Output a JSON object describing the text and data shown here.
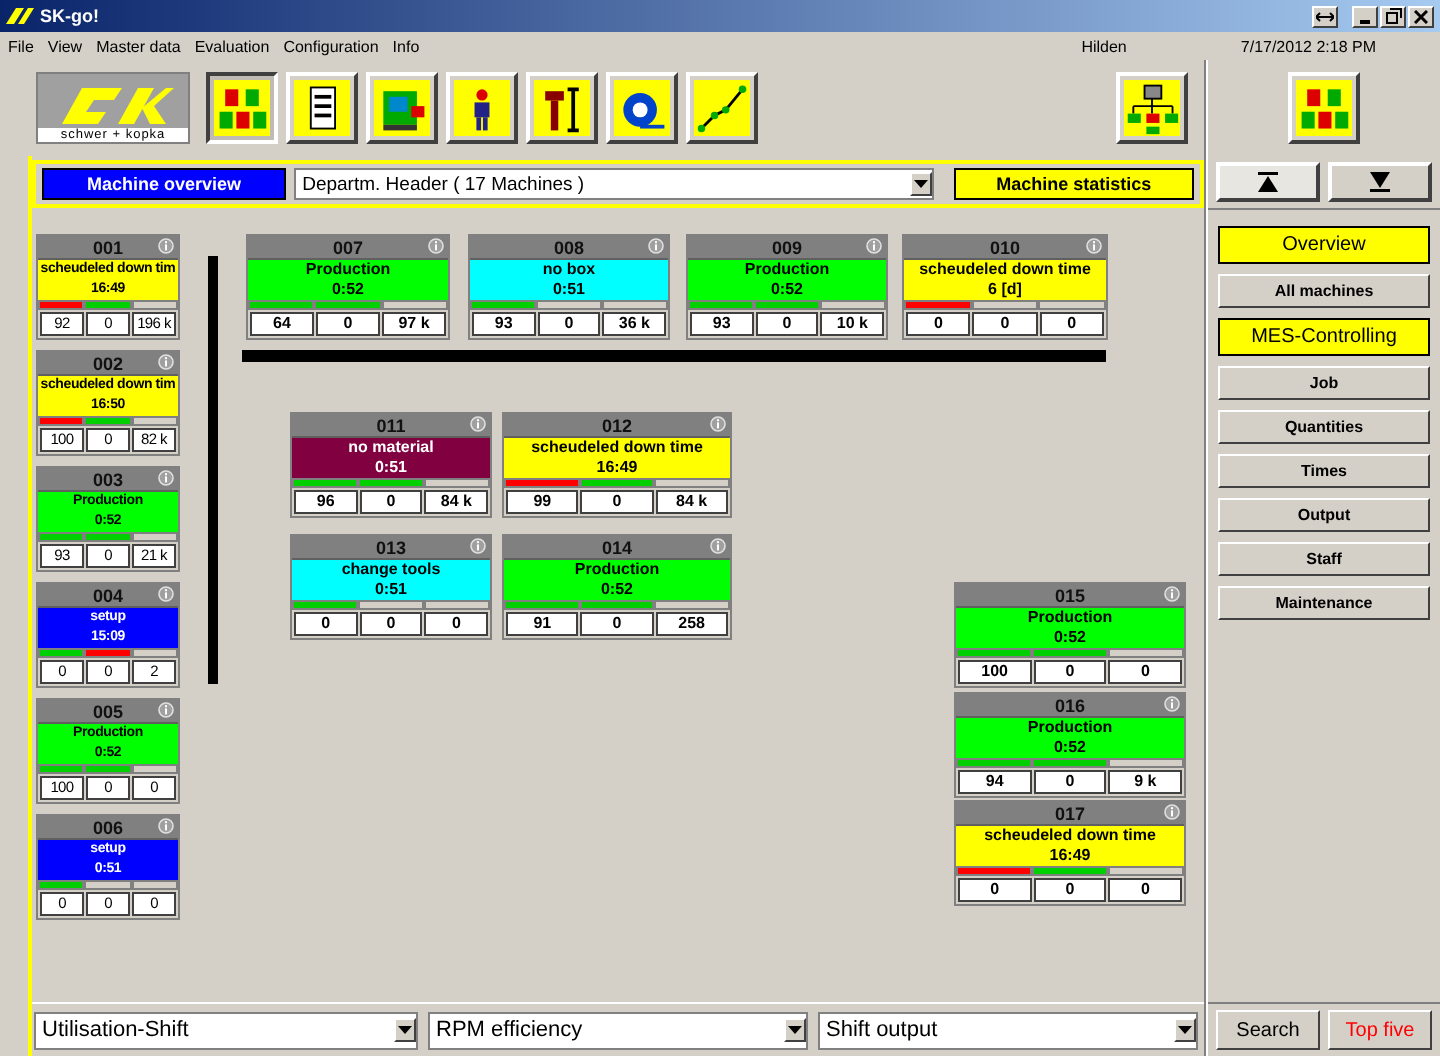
{
  "window": {
    "title": "SK-go!"
  },
  "menu": [
    "File",
    "View",
    "Master data",
    "Evaluation",
    "Configuration",
    "Info"
  ],
  "location": "Hilden",
  "datetime": "7/17/2012 2:18 PM",
  "logo": {
    "caption": "schwer + kopka"
  },
  "toolbar": [
    {
      "selected": true
    },
    {
      "selected": false
    },
    {
      "selected": false
    },
    {
      "selected": false
    },
    {
      "selected": false
    },
    {
      "selected": false
    },
    {
      "selected": false
    }
  ],
  "view_tabs": [
    {
      "label": "Machine overview",
      "selected": true
    },
    {
      "label": "Machine statistics",
      "selected": false
    }
  ],
  "department": {
    "value": "Departm. Header ( 17 Machines )"
  },
  "machines": [
    {
      "number": "001",
      "status": "scheudeled down tim",
      "time": "16:49",
      "color": "#ffff00",
      "bars": [
        {
          "color": "#ff0000"
        },
        {
          "color": "#00d000"
        },
        {
          "color": "#d4d0c8"
        }
      ],
      "values": [
        "92",
        "0",
        "196 k"
      ]
    },
    {
      "number": "002",
      "status": "scheudeled down tim",
      "time": "16:50",
      "color": "#ffff00",
      "bars": [
        {
          "color": "#ff0000"
        },
        {
          "color": "#00d000"
        },
        {
          "color": "#d4d0c8"
        }
      ],
      "values": [
        "100",
        "0",
        "82 k"
      ]
    },
    {
      "number": "003",
      "status": "Production",
      "time": "0:52",
      "color": "#00ff00",
      "bars": [
        {
          "color": "#00d000"
        },
        {
          "color": "#00d000"
        },
        {
          "color": "#d4d0c8"
        }
      ],
      "values": [
        "93",
        "0",
        "21 k"
      ]
    },
    {
      "number": "004",
      "status": "setup",
      "time": "15:09",
      "color": "#0000ff",
      "bars": [
        {
          "color": "#00d000"
        },
        {
          "color": "#ff0000"
        },
        {
          "color": "#d4d0c8"
        }
      ],
      "values": [
        "0",
        "0",
        "2"
      ]
    },
    {
      "number": "005",
      "status": "Production",
      "time": "0:52",
      "color": "#00ff00",
      "bars": [
        {
          "color": "#00d000"
        },
        {
          "color": "#00d000"
        },
        {
          "color": "#d4d0c8"
        }
      ],
      "values": [
        "100",
        "0",
        "0"
      ]
    },
    {
      "number": "006",
      "status": "setup",
      "time": "0:51",
      "color": "#0000ff",
      "bars": [
        {
          "color": "#00d000"
        },
        {
          "color": "#d4d0c8"
        },
        {
          "color": "#d4d0c8"
        }
      ],
      "values": [
        "0",
        "0",
        "0"
      ]
    },
    {
      "number": "007",
      "status": "Production",
      "time": "0:52",
      "color": "#00ff00",
      "bars": [
        {
          "color": "#00d000"
        },
        {
          "color": "#00d000"
        },
        {
          "color": "#d4d0c8"
        }
      ],
      "values": [
        "64",
        "0",
        "97 k"
      ]
    },
    {
      "number": "008",
      "status": "no box",
      "time": "0:51",
      "color": "#00ffff",
      "bars": [
        {
          "color": "#00d000"
        },
        {
          "color": "#d4d0c8"
        },
        {
          "color": "#d4d0c8"
        }
      ],
      "values": [
        "93",
        "0",
        "36 k"
      ]
    },
    {
      "number": "009",
      "status": "Production",
      "time": "0:52",
      "color": "#00ff00",
      "bars": [
        {
          "color": "#00d000"
        },
        {
          "color": "#00d000"
        },
        {
          "color": "#d4d0c8"
        }
      ],
      "values": [
        "93",
        "0",
        "10 k"
      ]
    },
    {
      "number": "010",
      "status": "scheudeled down time",
      "time": "6 [d]",
      "color": "#ffff00",
      "bars": [
        {
          "color": "#ff0000"
        },
        {
          "color": "#d4d0c8"
        },
        {
          "color": "#d4d0c8"
        }
      ],
      "values": [
        "0",
        "0",
        "0"
      ]
    },
    {
      "number": "011",
      "status": "no material",
      "time": "0:51",
      "color": "#800040",
      "bars": [
        {
          "color": "#00d000"
        },
        {
          "color": "#00d000"
        },
        {
          "color": "#d4d0c8"
        }
      ],
      "values": [
        "96",
        "0",
        "84 k"
      ]
    },
    {
      "number": "012",
      "status": "scheudeled down time",
      "time": "16:49",
      "color": "#ffff00",
      "bars": [
        {
          "color": "#ff0000"
        },
        {
          "color": "#00d000"
        },
        {
          "color": "#d4d0c8"
        }
      ],
      "values": [
        "99",
        "0",
        "84 k"
      ]
    },
    {
      "number": "013",
      "status": "change tools",
      "time": "0:51",
      "color": "#00ffff",
      "bars": [
        {
          "color": "#00d000"
        },
        {
          "color": "#d4d0c8"
        },
        {
          "color": "#d4d0c8"
        }
      ],
      "values": [
        "0",
        "0",
        "0"
      ]
    },
    {
      "number": "014",
      "status": "Production",
      "time": "0:52",
      "color": "#00ff00",
      "bars": [
        {
          "color": "#00d000"
        },
        {
          "color": "#00d000"
        },
        {
          "color": "#d4d0c8"
        }
      ],
      "values": [
        "91",
        "0",
        "258"
      ]
    },
    {
      "number": "015",
      "status": "Production",
      "time": "0:52",
      "color": "#00ff00",
      "bars": [
        {
          "color": "#00d000"
        },
        {
          "color": "#00d000"
        },
        {
          "color": "#d4d0c8"
        }
      ],
      "values": [
        "100",
        "0",
        "0"
      ]
    },
    {
      "number": "016",
      "status": "Production",
      "time": "0:52",
      "color": "#00ff00",
      "bars": [
        {
          "color": "#00d000"
        },
        {
          "color": "#00d000"
        },
        {
          "color": "#d4d0c8"
        }
      ],
      "values": [
        "94",
        "0",
        "9 k"
      ]
    },
    {
      "number": "017",
      "status": "scheudeled down time",
      "time": "16:49",
      "color": "#ffff00",
      "bars": [
        {
          "color": "#ff0000"
        },
        {
          "color": "#00d000"
        },
        {
          "color": "#d4d0c8"
        }
      ],
      "values": [
        "0",
        "0",
        "0"
      ]
    }
  ],
  "sidebar": {
    "items": [
      {
        "label": "Overview",
        "kind": "section"
      },
      {
        "label": "All machines",
        "kind": "item"
      },
      {
        "label": "MES-Controlling",
        "kind": "section"
      },
      {
        "label": "Job",
        "kind": "item"
      },
      {
        "label": "Quantities",
        "kind": "item"
      },
      {
        "label": "Times",
        "kind": "item"
      },
      {
        "label": "Output",
        "kind": "item"
      },
      {
        "label": "Staff",
        "kind": "item"
      },
      {
        "label": "Maintenance",
        "kind": "item"
      }
    ]
  },
  "bottom_selects": [
    {
      "value": "Utilisation-Shift"
    },
    {
      "value": "RPM efficiency"
    },
    {
      "value": "Shift output"
    }
  ],
  "bottom_buttons": [
    {
      "label": "Search",
      "highlighted": false
    },
    {
      "label": "Top five",
      "highlighted": true
    }
  ]
}
